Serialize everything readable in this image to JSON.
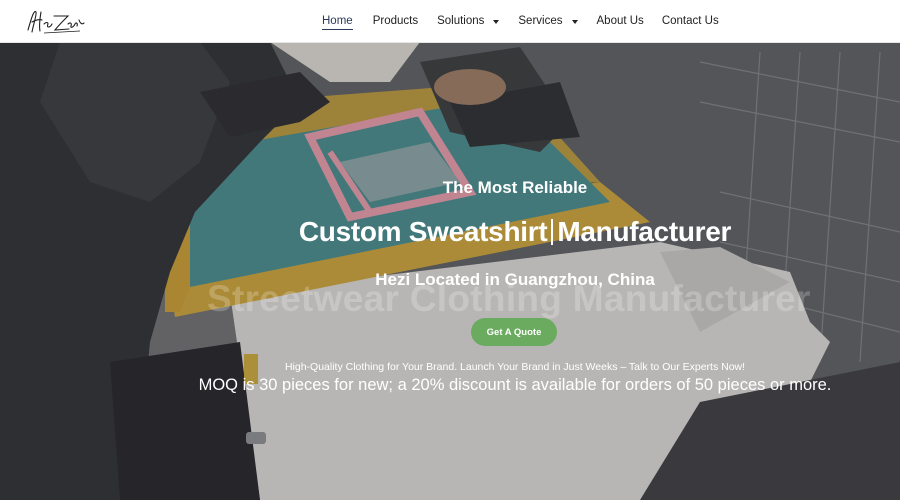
{
  "header": {
    "nav": [
      {
        "label": "Home",
        "active": true,
        "dropdown": false
      },
      {
        "label": "Products",
        "active": false,
        "dropdown": false
      },
      {
        "label": "Solutions",
        "active": false,
        "dropdown": true
      },
      {
        "label": "Services",
        "active": false,
        "dropdown": true
      },
      {
        "label": "About Us",
        "active": false,
        "dropdown": false
      },
      {
        "label": "Contact Us",
        "active": false,
        "dropdown": false
      }
    ]
  },
  "hero": {
    "kicker": "The Most Reliable",
    "headline_part1": "Custom Sweatshirt",
    "headline_part2": "Manufacturer",
    "location": "Hezi Located in Guangzhou, China",
    "ghost_text": "Streetwear Clothing Manufacturer",
    "cta_label": "Get A Quote",
    "tagline": "High-Quality Clothing for Your Brand. Launch Your Brand in Just Weeks – Talk to Our Experts Now!",
    "moq": "MOQ is 30 pieces for new; a 20% discount is available for orders of 50 pieces or more."
  },
  "colors": {
    "cta": "#6bab5f",
    "nav_active": "#2a3a5a"
  }
}
